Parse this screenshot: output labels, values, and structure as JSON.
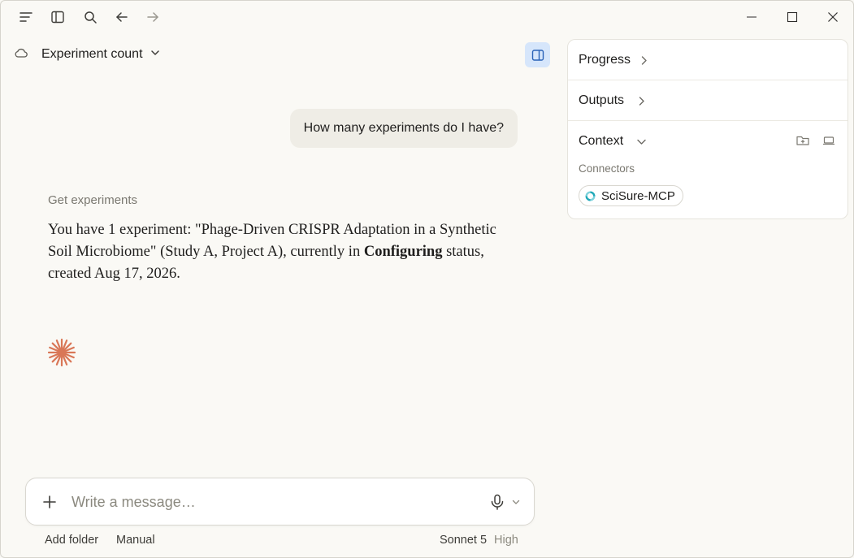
{
  "chat": {
    "title": "Experiment count",
    "user_message": "How many experiments do I have?",
    "tool_label": "Get experiments",
    "answer_part1": "You have 1 experiment: \"Phage-Driven CRISPR Adaptation in a Synthetic Soil Microbiome\" (Study A, Project A), currently in ",
    "answer_bold": "Configuring",
    "answer_part2": " status, created Aug 17, 2026."
  },
  "composer": {
    "placeholder": "Write a message…",
    "add_folder": "Add folder",
    "mode": "Manual",
    "model": "Sonnet 5",
    "effort": "High"
  },
  "side_panel": {
    "progress": "Progress",
    "outputs": "Outputs",
    "context": "Context",
    "connectors_label": "Connectors",
    "connector_name": "SciSure-MCP"
  },
  "colors": {
    "accent": "#d97757",
    "toggle_bg": "#d6e6fb",
    "connector": "#1fa8b8"
  },
  "icons": {
    "menu": "menu-icon",
    "sidebar": "sidebar-icon",
    "search": "search-icon",
    "back": "arrow-left-icon",
    "forward": "arrow-right-icon",
    "cloud": "cloud-icon",
    "spark": "spark-icon",
    "mic": "microphone-icon"
  }
}
